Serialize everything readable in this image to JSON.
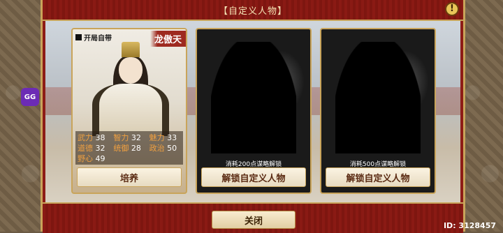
{
  "dialog": {
    "title": "【自定义人物】",
    "warn_icon": "!",
    "close_label": "关闭"
  },
  "hero": {
    "tag": "开局自带",
    "name": "龙傲天",
    "stats": [
      [
        {
          "k": "武力",
          "v": "38"
        },
        {
          "k": "智力",
          "v": "32"
        },
        {
          "k": "魅力",
          "v": "33"
        }
      ],
      [
        {
          "k": "道德",
          "v": "32"
        },
        {
          "k": "统御",
          "v": "28"
        },
        {
          "k": "政治",
          "v": "50"
        }
      ],
      [
        {
          "k": "野心",
          "v": "49"
        }
      ]
    ],
    "button": "培养"
  },
  "locked": [
    {
      "cost": "消耗200点谋略解锁",
      "button": "解锁自定义人物"
    },
    {
      "cost": "消耗500点谋略解锁",
      "button": "解锁自定义人物"
    }
  ],
  "overlay": {
    "gg_label": "GG",
    "id_text": "ID: 3128457"
  }
}
